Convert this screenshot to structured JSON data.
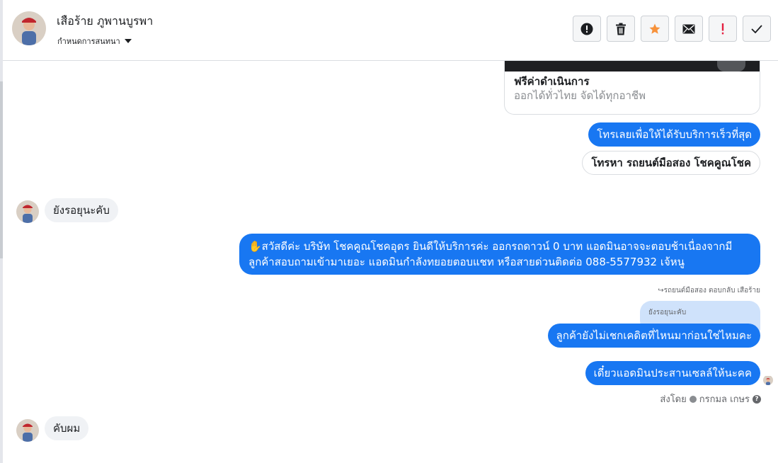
{
  "header": {
    "name": "เสือร้าย ภูพานบูรพา",
    "subtitle": "กำหนดการสนทนา"
  },
  "toolbar": {
    "buttons": [
      {
        "name": "spam-report",
        "icon": "exclamation-circle-icon"
      },
      {
        "name": "delete",
        "icon": "trash-icon"
      },
      {
        "name": "star",
        "icon": "star-icon",
        "color": "#f7923b"
      },
      {
        "name": "mark-unread",
        "icon": "envelope-icon"
      },
      {
        "name": "follow-up",
        "icon": "exclamation-icon",
        "color": "#e41e3f"
      },
      {
        "name": "mark-done",
        "icon": "checkmark-icon"
      }
    ]
  },
  "card": {
    "title": "ฟรีค่าดำเนินการ",
    "subtitle": "ออกได้ทั่วไทย จัดได้ทุกอาชีพ"
  },
  "messages": {
    "out_call_now": "โทรเลยเพื่อให้ได้รับบริการเร็วที่สุด",
    "out_call_button": "โทรหา รถยนต์มือสอง โชคคูณโชค",
    "in_waiting": "ยังรอยุนะคับ",
    "out_greeting_line1": "✋สวัสดีค่ะ บริษัท โชคคูณโชคอุดร ยินดีให้บริการค่ะ ออกรถดาวน์ 0 บาท แอดมินอาจจะตอบช้าเนื่องจากมี",
    "out_greeting_line2": "ลูกค้าสอบถามเข้ามาเยอะ แอดมินกำลังทยอยตอบแชท หรือสายด่วนติดต่อ 088-5577932 เจ้หนู",
    "reply_meta": "รถยนต์มือสอง ตอบกลับ เสือร้าย",
    "quoted_text": "ยังรอยุนะคับ",
    "out_credit_check": "ลูกค้ายังไม่เชกเคดิตที่ไหนมาก่อนใช่ไหมคะ",
    "out_coordinate": "เดี๋ยวแอดมินประสานเซลล์ให้นะคค",
    "sent_by_label": "ส่งโดย",
    "sent_by_name": "กรกมล เกษร",
    "in_ok": "คับผม"
  },
  "colors": {
    "outgoing": "#1877f2",
    "incoming": "#f0f2f5",
    "quoted": "#cfe2fb"
  }
}
